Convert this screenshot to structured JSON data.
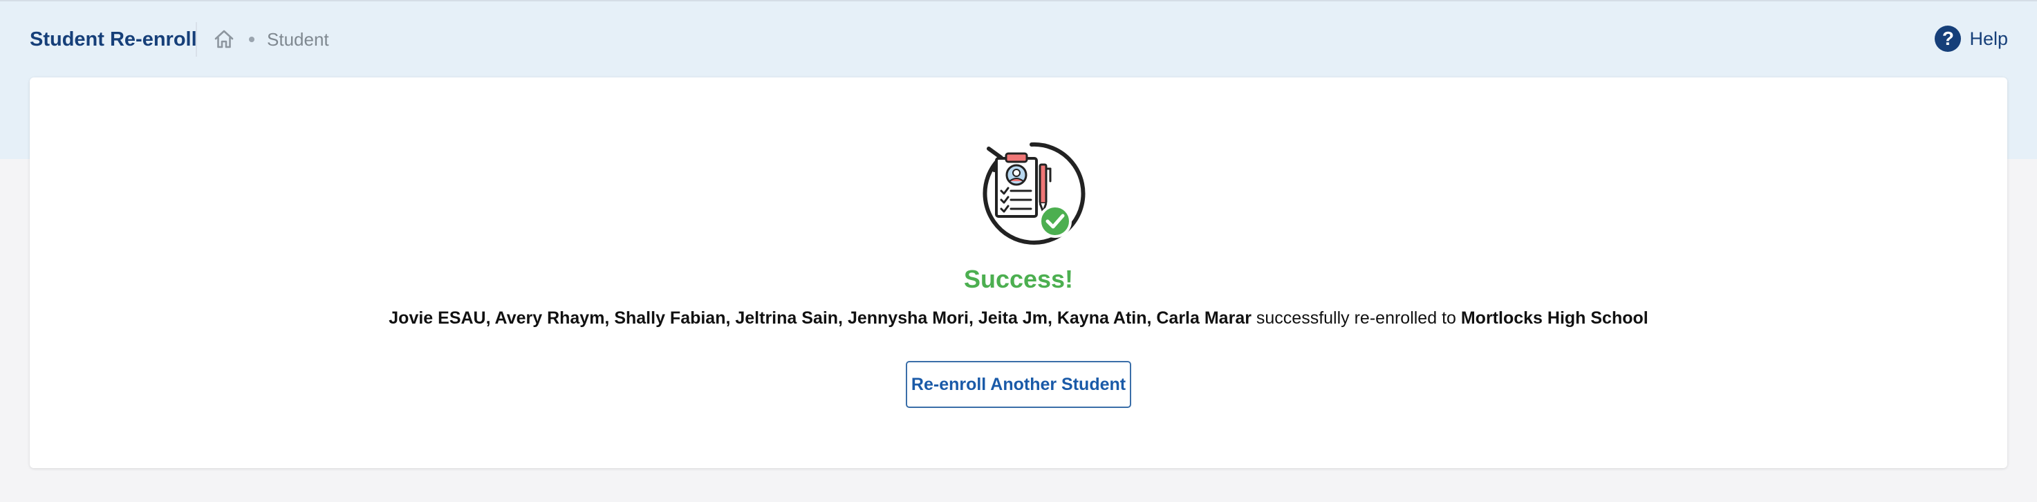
{
  "header": {
    "app_title": "Student Re-enroll",
    "breadcrumb": {
      "home_icon": "home-icon",
      "current": "Student"
    },
    "help": {
      "label": "Help",
      "icon": "question-circle-icon"
    }
  },
  "main": {
    "illustration_icon": "reenroll-document-success-icon",
    "title": "Success!",
    "message": {
      "students": "Jovie ESAU, Avery Rhaym, Shally Fabian, Jeltrina Sain, Jennysha Mori, Jeita Jm, Kayna Atin, Carla Marar",
      "middle_text": " successfully re-enrolled to ",
      "school": "Mortlocks High School"
    },
    "button_label": "Re-enroll Another Student"
  },
  "colors": {
    "brand": "#163f79",
    "success": "#4caf50",
    "header_background": "#e6f0f8",
    "page_background": "#f4f4f6",
    "button_border": "#3a6ea8"
  }
}
